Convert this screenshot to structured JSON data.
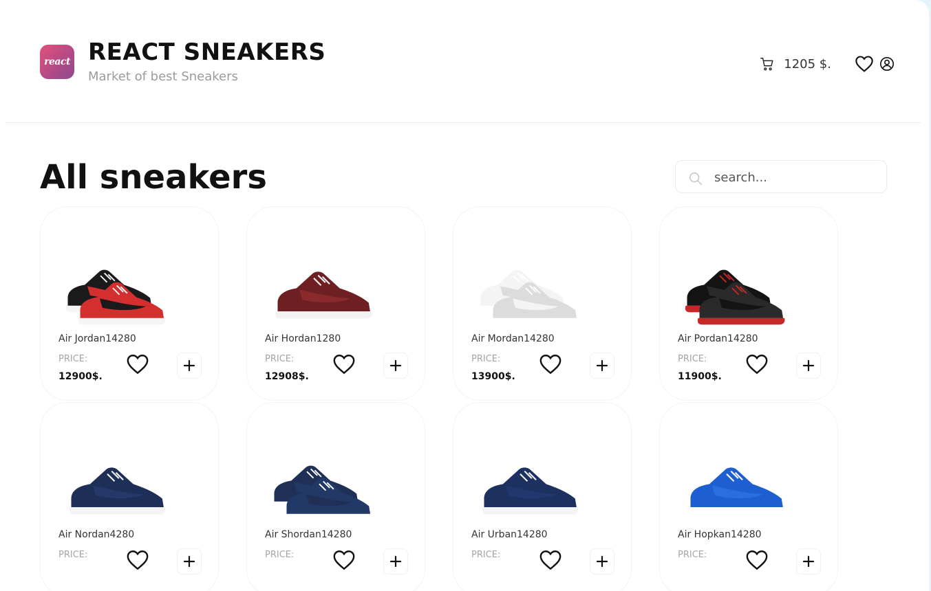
{
  "header": {
    "logo_text": "react",
    "title": "REACT SNEAKERS",
    "subtitle": "Market of best Sneakers",
    "cart_total": "1205 $."
  },
  "main": {
    "title": "All sneakers",
    "search": {
      "placeholder": "search...",
      "value": ""
    }
  },
  "price_label": "PRICE:",
  "products": [
    {
      "name": "Air Jordan14280",
      "price": "12900$."
    },
    {
      "name": "Air Hordan1280",
      "price": "12908$."
    },
    {
      "name": "Air Mordan14280",
      "price": "13900$."
    },
    {
      "name": "Air Pordan14280",
      "price": "11900$."
    },
    {
      "name": "Air Nordan4280",
      "price": ""
    },
    {
      "name": "Air Shordan14280",
      "price": ""
    },
    {
      "name": "Air Urban14280",
      "price": ""
    },
    {
      "name": "Air Hopkan14280",
      "price": ""
    }
  ],
  "product_images": [
    {
      "icon": "sneaker-high-red-black",
      "colors": [
        "#1a1a1a",
        "#d32f2f",
        "#f5f5f5"
      ]
    },
    {
      "icon": "sneaker-low-maroon",
      "colors": [
        "#6e1f22",
        "#8a2a2c",
        "#f2f2f2"
      ]
    },
    {
      "icon": "sneaker-high-white",
      "colors": [
        "#f4f4f4",
        "#dcdcdc",
        "#ffffff"
      ]
    },
    {
      "icon": "sneaker-high-black-red",
      "colors": [
        "#141414",
        "#2a2a2a",
        "#c62828"
      ]
    },
    {
      "icon": "sneaker-low-navy",
      "colors": [
        "#1e2f57",
        "#24386a",
        "#f4f4f4"
      ]
    },
    {
      "icon": "sneaker-runner-navy-pair",
      "colors": [
        "#1f2f55",
        "#223866",
        "#ffffff"
      ]
    },
    {
      "icon": "sneaker-runner-navy",
      "colors": [
        "#1d3160",
        "#20386e",
        "#f4f4f4"
      ]
    },
    {
      "icon": "sneaker-runner-blue",
      "colors": [
        "#1d5fd0",
        "#2a6ee0",
        "#ffffff"
      ]
    }
  ]
}
